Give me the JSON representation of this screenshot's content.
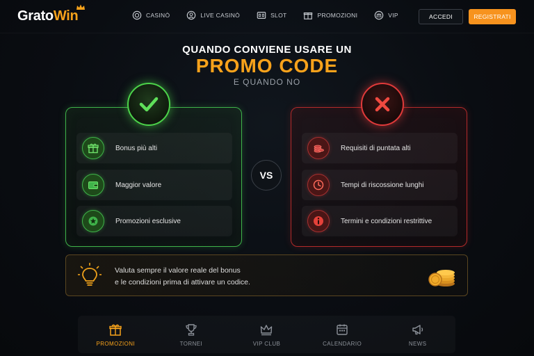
{
  "brand": {
    "name_part1": "Grato",
    "name_part2": "Win",
    "accent": "#f7a21b"
  },
  "nav": [
    {
      "label": "CASINÒ",
      "icon": "casino-chip-icon"
    },
    {
      "label": "LIVE CASINÒ",
      "icon": "live-dealer-icon"
    },
    {
      "label": "SLOT",
      "icon": "slot-machine-icon"
    },
    {
      "label": "PROMOZIONI",
      "icon": "gift-icon"
    },
    {
      "label": "VIP",
      "icon": "vip-crown-icon"
    }
  ],
  "auth": {
    "login": "ACCEDI",
    "register": "REGISTRATI"
  },
  "hero": {
    "line1": "QUANDO CONVIENE USARE UN",
    "line2": "PROMO CODE",
    "line3": "E QUANDO NO"
  },
  "pros": {
    "badge_icon": "checkmark-icon",
    "color": "#4cd44a",
    "items": [
      {
        "label": "Bonus più alti",
        "icon": "gift-icon"
      },
      {
        "label": "Maggior valore",
        "icon": "wallet-icon"
      },
      {
        "label": "Promozioni esclusive",
        "icon": "star-badge-icon"
      }
    ]
  },
  "cons": {
    "badge_icon": "cross-icon",
    "color": "#e13a3a",
    "items": [
      {
        "label": "Requisiti di puntata alti",
        "icon": "coin-stack-icon"
      },
      {
        "label": "Tempi di riscossione lunghi",
        "icon": "clock-icon"
      },
      {
        "label": "Termini e condizioni restrittive",
        "icon": "info-icon"
      }
    ]
  },
  "vs_label": "VS",
  "tip": {
    "line1": "Valuta sempre il valore reale del bonus",
    "line2": "e le condizioni prima di attivare un codice.",
    "icon": "lightbulb-icon",
    "decoration": "gold-coins-icon"
  },
  "bottom_nav": [
    {
      "label": "PROMOZIONI",
      "icon": "gift-icon",
      "active": true
    },
    {
      "label": "TORNEI",
      "icon": "trophy-icon",
      "active": false
    },
    {
      "label": "VIP CLUB",
      "icon": "crown-icon",
      "active": false
    },
    {
      "label": "CALENDARIO",
      "icon": "calendar-icon",
      "active": false
    },
    {
      "label": "NEWS",
      "icon": "megaphone-icon",
      "active": false
    }
  ]
}
